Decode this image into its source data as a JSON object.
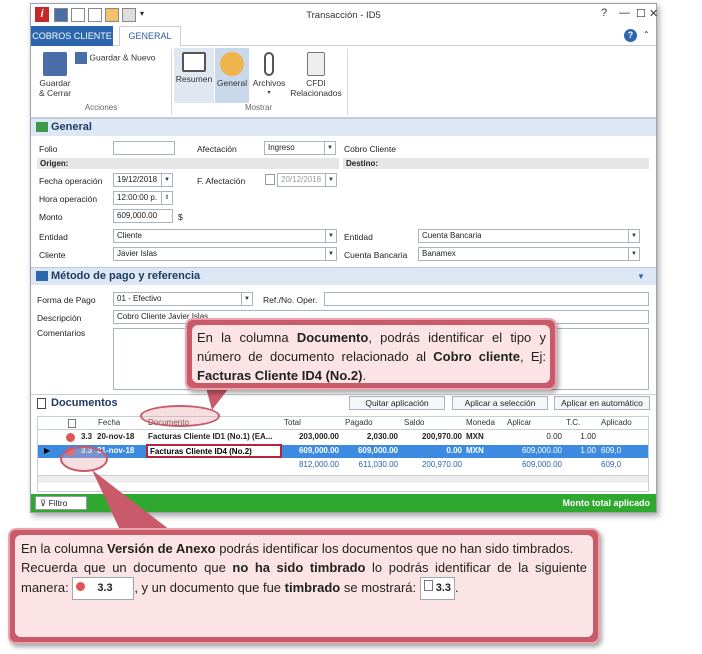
{
  "window": {
    "title": "Transacción - ID5"
  },
  "tabs": [
    "COBROS CLIENTE",
    "GENERAL"
  ],
  "ribbon": {
    "guardar_cerrar": "Guardar\n& Cerrar",
    "guardar_nuevo": "Guardar & Nuevo",
    "grupo_acciones": "Acciones",
    "resumen": "Resumen",
    "general": "General",
    "archivos": "Archivos",
    "cfdi": "CFDI\nRelacionados",
    "grupo_mostrar": "Mostrar"
  },
  "general": {
    "header": "General",
    "folio_label": "Folio",
    "afectacion_label": "Afectación",
    "afectacion": "Ingreso",
    "cobro_cliente_label": "Cobro Cliente",
    "origen": "Origen:",
    "destino": "Destino:",
    "fecha_op_label": "Fecha operación",
    "fecha_op": "19/12/2018",
    "f_afectacion_label": "F. Afectación",
    "f_afectacion": "20/12/2018",
    "hora_label": "Hora operación",
    "hora": "12:00:00 p.",
    "monto_label": "Monto",
    "monto": "609,000.00",
    "monto_symbol": "$",
    "entidad_label": "Entidad",
    "entidad": "Cliente",
    "entidad2_label": "Entidad",
    "entidad2": "Cuenta Bancaria",
    "cliente_label": "Cliente",
    "cliente": "Javier Islas",
    "cuenta_label": "Cuenta Bancaria",
    "cuenta": "Banamex"
  },
  "metodo": {
    "header": "Método de pago y referencia",
    "forma_label": "Forma de Pago",
    "forma": "01 - Efectivo",
    "ref_label": "Ref./No. Oper.",
    "desc_label": "Descripción",
    "desc": "Cobro Cliente Javier Islas",
    "coment_label": "Comentarios"
  },
  "documentos": {
    "header": "Documentos",
    "btn_quitar": "Quitar aplicación",
    "btn_seleccion": "Aplicar a selección",
    "btn_auto": "Aplicar en automático",
    "columns": [
      "Fecha",
      "Documento",
      "Total",
      "Pagado",
      "Saldo",
      "Moneda",
      "Aplicar",
      "T.C.",
      "Aplicado"
    ],
    "rows": [
      {
        "version": "3.3",
        "fecha": "20-nov-18",
        "documento": "Facturas Cliente ID1 (No.1) (EA...",
        "total": "203,000.00",
        "pagado": "2,030.00",
        "saldo": "200,970.00",
        "moneda": "MXN",
        "aplicar": "0.00",
        "tc": "1.00",
        "aplicado": ""
      },
      {
        "version": "3.3",
        "fecha": "21-nov-18",
        "documento": "Facturas Cliente ID4 (No.2)",
        "total": "609,000.00",
        "pagado": "609,000.00",
        "saldo": "0.00",
        "moneda": "MXN",
        "aplicar": "609,000.00",
        "tc": "1.00",
        "aplicado": "609,0"
      }
    ],
    "totals": {
      "total": "812,000.00",
      "pagado": "611,030.00",
      "saldo": "200,970.00",
      "aplicar": "609,000.00",
      "aplicado": "609,0"
    }
  },
  "footer": {
    "filtro": "Filtro",
    "monto_total": "Monto total aplicado"
  },
  "callout_top": {
    "p1": "En la columna ",
    "b1": "Documento",
    "p2": ", podrás identificar el tipo y número de documento relacionado al ",
    "b2": "Cobro cliente",
    "p3": ", Ej: ",
    "b3": "Facturas Cliente ID4 (No.2)",
    "p4": "."
  },
  "callout_bottom": {
    "p1": "En la columna ",
    "b1": "Versión de Anexo",
    "p2": " podrás identificar los documentos que no han sido timbrados.",
    "p3": "Recuerda que un documento que ",
    "b2": "no ha sido timbrado",
    "p4": " lo podrás identificar de la siguiente manera: ",
    "stamp": "3.3",
    "p5": ", y un documento que fue ",
    "b3": "timbrado",
    "p6": " se mostrará: ",
    "p7": "."
  },
  "colors": {
    "accent": "#2b66ae",
    "callout_border": "#c85a6a",
    "callout_fill": "#fce4e6",
    "footer": "#2ea82e",
    "selected_row": "#3d8be0"
  }
}
